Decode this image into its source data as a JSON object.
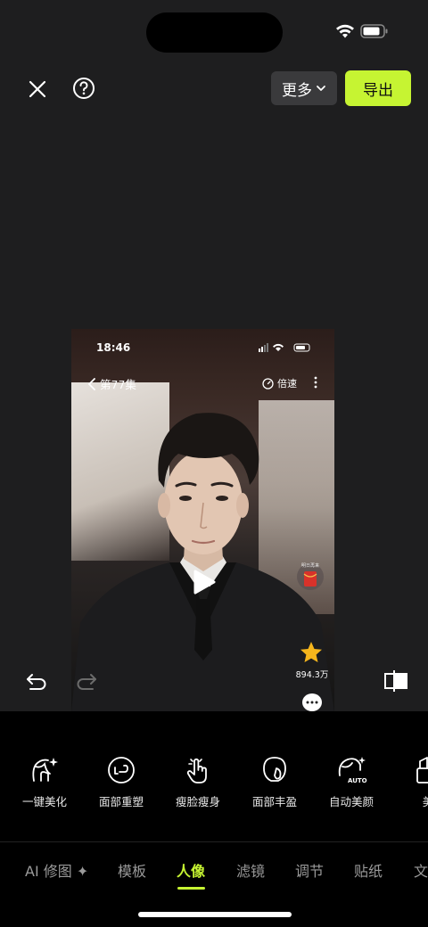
{
  "topbar": {
    "more_label": "更多",
    "export_label": "导出"
  },
  "preview": {
    "status_time": "18:46",
    "back_label": "第77集",
    "speed_label": "倍速",
    "redpacket_label": "明日再来",
    "favorite_count": "894.3万"
  },
  "tools": [
    {
      "label": "一键美化",
      "icon": "face-sparkle-icon"
    },
    {
      "label": "面部重塑",
      "icon": "face-reshape-icon"
    },
    {
      "label": "瘦脸瘦身",
      "icon": "hand-tap-icon"
    },
    {
      "label": "面部丰盈",
      "icon": "face-fill-icon"
    },
    {
      "label": "自动美颜",
      "icon": "auto-beauty-icon"
    },
    {
      "label": "美",
      "icon": "makeup-icon"
    }
  ],
  "tabs": [
    {
      "label": "AI 修图 ✦",
      "active": false
    },
    {
      "label": "模板",
      "active": false
    },
    {
      "label": "人像",
      "active": true
    },
    {
      "label": "滤镜",
      "active": false
    },
    {
      "label": "调节",
      "active": false
    },
    {
      "label": "贴纸",
      "active": false
    },
    {
      "label": "文",
      "active": false
    }
  ],
  "colors": {
    "accent": "#c6f432",
    "background": "#1e1e1f",
    "panel": "#000000"
  }
}
